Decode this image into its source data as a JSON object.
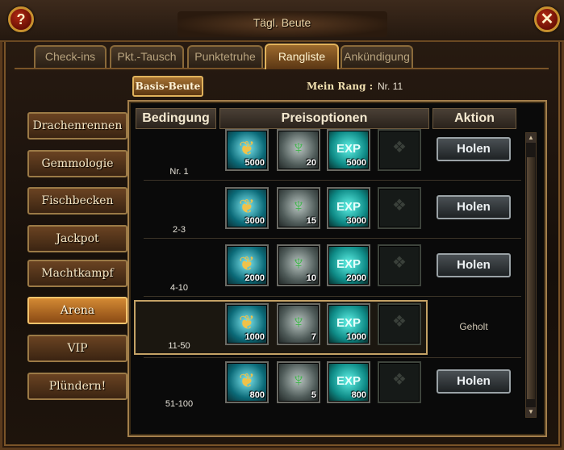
{
  "window": {
    "title": "Tägl. Beute",
    "help_glyph": "?",
    "close_glyph": "✕"
  },
  "tabs": [
    {
      "label": "Check-ins",
      "active": false
    },
    {
      "label": "Pkt.-Tausch",
      "active": false
    },
    {
      "label": "Punktetruhe",
      "active": false
    },
    {
      "label": "Rangliste",
      "active": true
    },
    {
      "label": "Ankündigung",
      "active": false
    }
  ],
  "subtab": {
    "label": "Basis-Beute"
  },
  "my_rank": {
    "label": "Mein Rang :",
    "value": "Nr. 11"
  },
  "sidebar": [
    {
      "label": "Drachenrennen",
      "active": false
    },
    {
      "label": "Gemmologie",
      "active": false
    },
    {
      "label": "Fischbecken",
      "active": false
    },
    {
      "label": "Jackpot",
      "active": false
    },
    {
      "label": "Machtkampf",
      "active": false
    },
    {
      "label": "Arena",
      "active": true
    },
    {
      "label": "VIP",
      "active": false
    },
    {
      "label": "Plündern!",
      "active": false
    }
  ],
  "table": {
    "headers": {
      "condition": "Bedingung",
      "rewards": "Preisoptionen",
      "action": "Aktion"
    },
    "rows": [
      {
        "rank": "Nr. 1",
        "rewards": [
          {
            "icon": "wings-item-icon",
            "qty": "5000"
          },
          {
            "icon": "silver-coin-icon",
            "qty": "20"
          },
          {
            "icon": "exp-orb-icon",
            "qty": "5000"
          },
          {
            "icon": "empty-slot-icon",
            "qty": ""
          }
        ],
        "action": "Holen",
        "claimed": false
      },
      {
        "rank": "2-3",
        "rewards": [
          {
            "icon": "wings-item-icon",
            "qty": "3000"
          },
          {
            "icon": "silver-coin-icon",
            "qty": "15"
          },
          {
            "icon": "exp-orb-icon",
            "qty": "3000"
          },
          {
            "icon": "empty-slot-icon",
            "qty": ""
          }
        ],
        "action": "Holen",
        "claimed": false
      },
      {
        "rank": "4-10",
        "rewards": [
          {
            "icon": "wings-item-icon",
            "qty": "2000"
          },
          {
            "icon": "silver-coin-icon",
            "qty": "10"
          },
          {
            "icon": "exp-orb-icon",
            "qty": "2000"
          },
          {
            "icon": "empty-slot-icon",
            "qty": ""
          }
        ],
        "action": "Holen",
        "claimed": false
      },
      {
        "rank": "11-50",
        "rewards": [
          {
            "icon": "wings-item-icon",
            "qty": "1000"
          },
          {
            "icon": "silver-coin-icon",
            "qty": "7"
          },
          {
            "icon": "exp-orb-icon",
            "qty": "1000"
          },
          {
            "icon": "empty-slot-icon",
            "qty": ""
          }
        ],
        "action": "Geholt",
        "claimed": true
      },
      {
        "rank": "51-100",
        "rewards": [
          {
            "icon": "wings-item-icon",
            "qty": "800"
          },
          {
            "icon": "silver-coin-icon",
            "qty": "5"
          },
          {
            "icon": "exp-orb-icon",
            "qty": "800"
          },
          {
            "icon": "empty-slot-icon",
            "qty": ""
          }
        ],
        "action": "Holen",
        "claimed": false
      }
    ]
  },
  "icons": {
    "wings": "❦",
    "coin": "♆",
    "exp": "EXP",
    "empty": "❖",
    "scroll_up": "▲",
    "scroll_down": "▼"
  }
}
